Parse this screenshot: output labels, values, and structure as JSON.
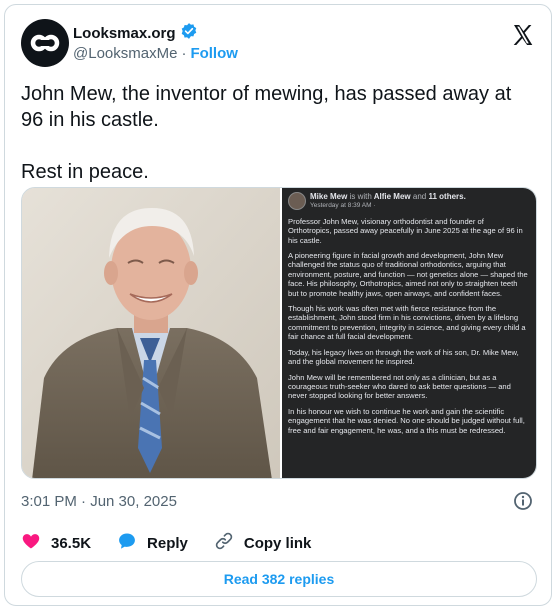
{
  "author": {
    "display_name": "Looksmax.org",
    "handle": "@LooksmaxMe",
    "separator": "·",
    "follow_label": "Follow"
  },
  "tweet": {
    "text": "John Mew, the inventor of mewing, has passed away at 96 in his castle.\n\nRest in peace.",
    "timestamp": "3:01 PM · Jun 30, 2025"
  },
  "embedded_post": {
    "author": "Mike Mew",
    "with_text": "is with",
    "tagged": "Alfie Mew",
    "and_text": "and",
    "others": "11 others.",
    "time": "Yesterday at 8:39 AM · ",
    "paragraphs": [
      "Professor John Mew, visionary orthodontist and founder of Orthotropics, passed away peacefully in June 2025 at the age of 96 in his castle.",
      "A pioneering figure in facial growth and development, John Mew challenged the status quo of traditional orthodontics, arguing that environment, posture, and function — not genetics alone — shaped the face. His philosophy, Orthotropics, aimed not only to straighten teeth but to promote healthy jaws, open airways, and confident faces.",
      "Though his work was often met with fierce resistance from the establishment, John stood firm in his convictions, driven by a lifelong commitment to prevention, integrity in science, and giving every child a fair chance at full facial development.",
      "Today, his legacy lives on through the work of his son, Dr. Mike Mew, and the global movement he inspired.",
      "John Mew will be remembered not only as a clinician, but as a courageous truth-seeker who dared to ask better questions — and never stopped looking for better answers.",
      "In his honour we wish to continue he work and gain the scientific engagement that he was denied. No one should be judged without full, free and fair engagement, he was, and a this must be redressed."
    ]
  },
  "actions": {
    "likes": "36.5K",
    "reply_label": "Reply",
    "copy_link_label": "Copy link"
  },
  "read_replies_label": "Read 382 replies",
  "icons": {
    "avatar": "looksmax-logo-icon",
    "verified": "verified-badge-icon",
    "platform": "x-logo-icon",
    "info": "info-icon",
    "like": "heart-icon",
    "reply": "speech-bubble-icon",
    "copy": "link-icon"
  },
  "colors": {
    "accent": "#1d9bf0",
    "like": "#f91880",
    "text": "#0f1419",
    "muted": "#536471",
    "border": "#cfd9de"
  }
}
